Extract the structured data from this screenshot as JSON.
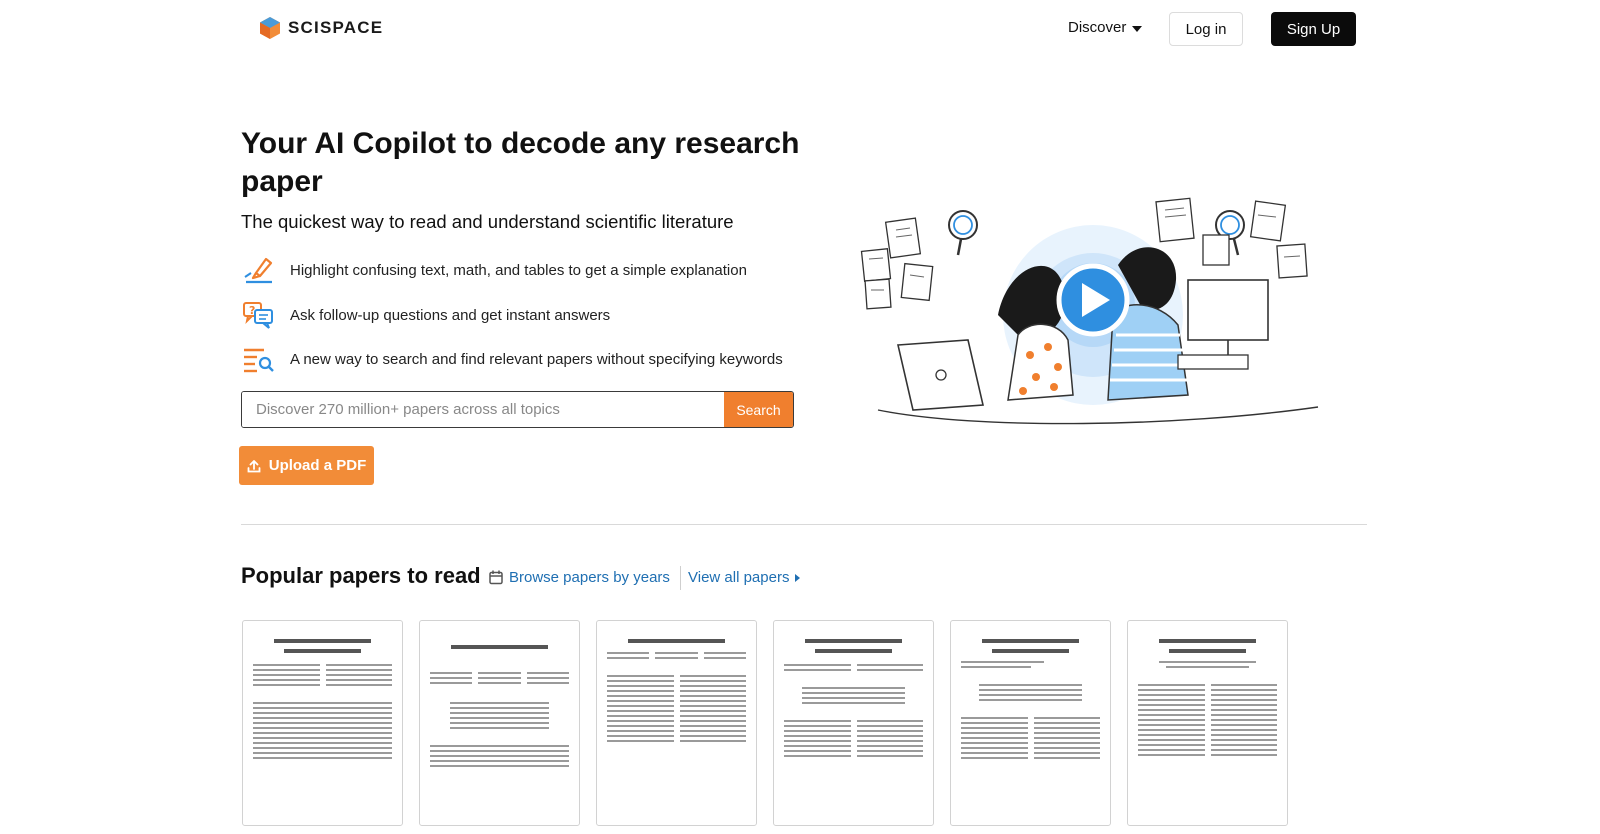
{
  "header": {
    "logo_text": "SCISPACE",
    "discover_label": "Discover",
    "login_label": "Log in",
    "signup_label": "Sign Up"
  },
  "hero": {
    "title": "Your AI Copilot to decode any research paper",
    "subtitle": "The quickest way to read and understand scientific literature",
    "features": [
      {
        "icon": "highlighter-icon",
        "text": "Highlight confusing text, math, and tables to get a simple explanation"
      },
      {
        "icon": "chat-question-icon",
        "text": "Ask follow-up questions and get instant answers"
      },
      {
        "icon": "search-list-icon",
        "text": "A new way to search and find relevant papers without specifying keywords"
      }
    ],
    "search": {
      "placeholder": "Discover 270 million+ papers across all topics",
      "button_label": "Search"
    },
    "upload_label": "Upload a PDF"
  },
  "popular": {
    "title": "Popular papers to read",
    "browse_label": "Browse papers by years",
    "view_all_label": "View all papers"
  },
  "colors": {
    "accent_orange": "#f07f2e",
    "link_blue": "#1f6fb2",
    "signup_black": "#0b0b0b",
    "illustration_blue": "#2f8fe0"
  }
}
